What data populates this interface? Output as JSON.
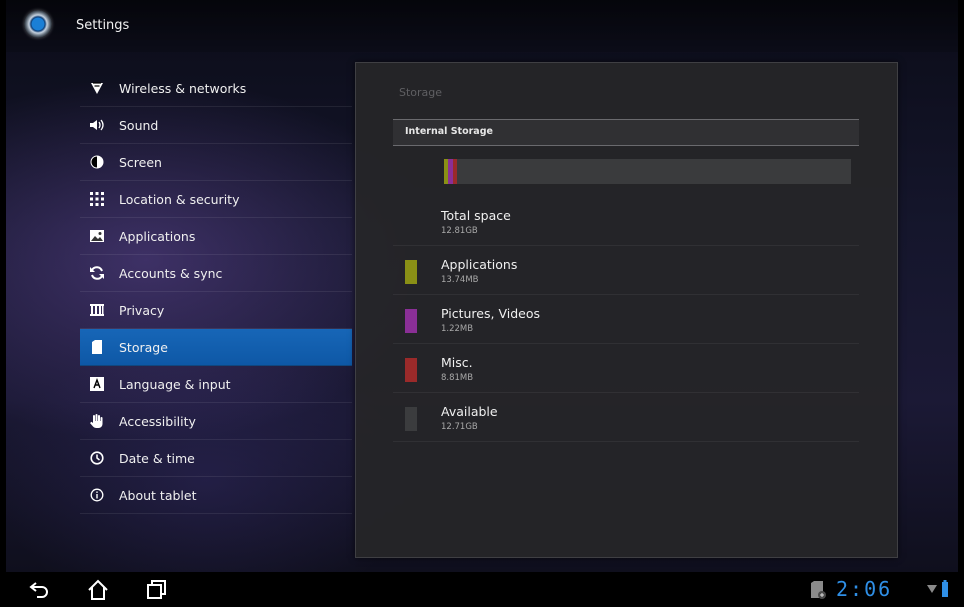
{
  "app": {
    "title": "Settings"
  },
  "menu": {
    "items": [
      {
        "label": "Wireless & networks",
        "icon": "wifi-icon"
      },
      {
        "label": "Sound",
        "icon": "speaker-icon"
      },
      {
        "label": "Screen",
        "icon": "brightness-icon"
      },
      {
        "label": "Location & security",
        "icon": "grid-icon"
      },
      {
        "label": "Applications",
        "icon": "image-icon"
      },
      {
        "label": "Accounts & sync",
        "icon": "sync-icon"
      },
      {
        "label": "Privacy",
        "icon": "privacy-icon"
      },
      {
        "label": "Storage",
        "icon": "sd-card-icon",
        "selected": true
      },
      {
        "label": "Language & input",
        "icon": "keyboard-letter-icon"
      },
      {
        "label": "Accessibility",
        "icon": "hand-icon"
      },
      {
        "label": "Date & time",
        "icon": "clock-icon"
      },
      {
        "label": "About tablet",
        "icon": "info-icon"
      }
    ]
  },
  "storage": {
    "title": "Storage",
    "section_label": "Internal Storage",
    "usage_bar": {
      "segments": [
        {
          "name": "Applications",
          "color": "#8a9016",
          "fraction": 0.011
        },
        {
          "name": "Pictures, Videos",
          "color": "#8a2f96",
          "fraction": 0.012
        },
        {
          "name": "Misc.",
          "color": "#9a2a2a",
          "fraction": 0.008
        }
      ]
    },
    "rows": [
      {
        "label": "Total space",
        "value": "12.81GB",
        "color": null
      },
      {
        "label": "Applications",
        "value": "13.74MB",
        "color": "#8a9016"
      },
      {
        "label": "Pictures, Videos",
        "value": "1.22MB",
        "color": "#8a2f96"
      },
      {
        "label": "Misc.",
        "value": "8.81MB",
        "color": "#9a2a2a"
      },
      {
        "label": "Available",
        "value": "12.71GB",
        "color": "#3b3c3e"
      }
    ]
  },
  "system_bar": {
    "time": "2:06",
    "icons": [
      "back-icon",
      "home-icon",
      "recent-apps-icon",
      "sd-card-status-icon",
      "signal-icon",
      "battery-icon"
    ],
    "accent_color": "#2f8fe6"
  }
}
